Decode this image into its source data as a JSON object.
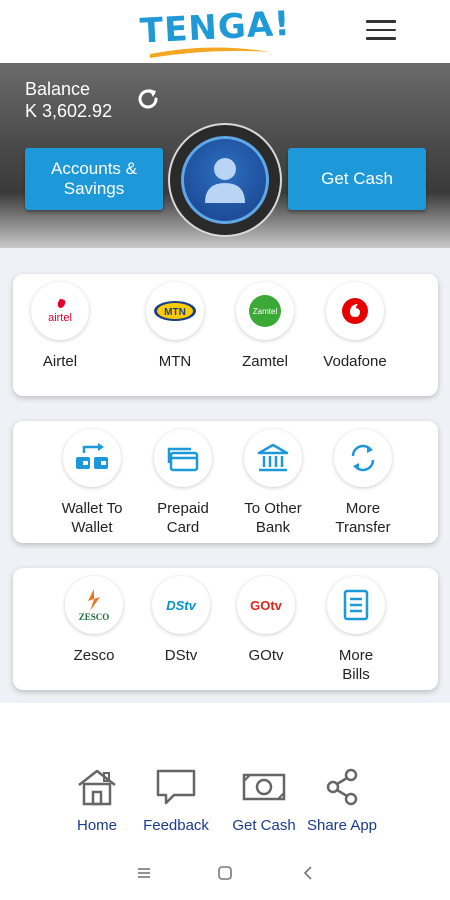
{
  "header": {
    "logo_text": "TENGA!",
    "menu_icon": "hamburger-menu-icon"
  },
  "hero": {
    "balance_label": "Balance",
    "balance_amount": "K 3,602.92",
    "refresh_icon": "refresh-icon",
    "accounts_button": "Accounts &\nSavings",
    "get_cash_button": "Get Cash",
    "avatar_icon": "user-avatar-icon"
  },
  "airtime": {
    "items": [
      {
        "label": "Airtel",
        "icon": "airtel-logo"
      },
      {
        "label": "MTN",
        "icon": "mtn-logo"
      },
      {
        "label": "Zamtel",
        "icon": "zamtel-logo"
      },
      {
        "label": "Vodafone",
        "icon": "vodafone-logo"
      }
    ]
  },
  "transfer": {
    "items": [
      {
        "label": "Wallet To\nWallet",
        "icon": "wallet-transfer-icon"
      },
      {
        "label": "Prepaid\nCard",
        "icon": "prepaid-card-icon"
      },
      {
        "label": "To Other\nBank",
        "icon": "bank-icon"
      },
      {
        "label": "More\nTransfer",
        "icon": "transfer-cycle-icon"
      }
    ]
  },
  "bills": {
    "items": [
      {
        "label": "Zesco",
        "icon": "zesco-logo"
      },
      {
        "label": "DStv",
        "icon": "dstv-logo"
      },
      {
        "label": "GOtv",
        "icon": "gotv-logo"
      },
      {
        "label": "More\nBills",
        "icon": "document-icon"
      }
    ]
  },
  "logos": {
    "airtel": "airtel",
    "mtn": "MTN",
    "zamtel": "Zamtel",
    "zesco": "ZESCO",
    "dstv": "DStv",
    "gotv": "GOtv"
  },
  "bottom_nav": {
    "items": [
      {
        "label": "Home",
        "icon": "home-icon"
      },
      {
        "label": "Feedback",
        "icon": "feedback-icon"
      },
      {
        "label": "Get Cash",
        "icon": "cash-icon"
      },
      {
        "label": "Share App",
        "icon": "share-icon"
      }
    ]
  },
  "colors": {
    "accent": "#1d98d8",
    "nav_label": "#1a3a8c",
    "logo_underline": "#f5a623"
  }
}
